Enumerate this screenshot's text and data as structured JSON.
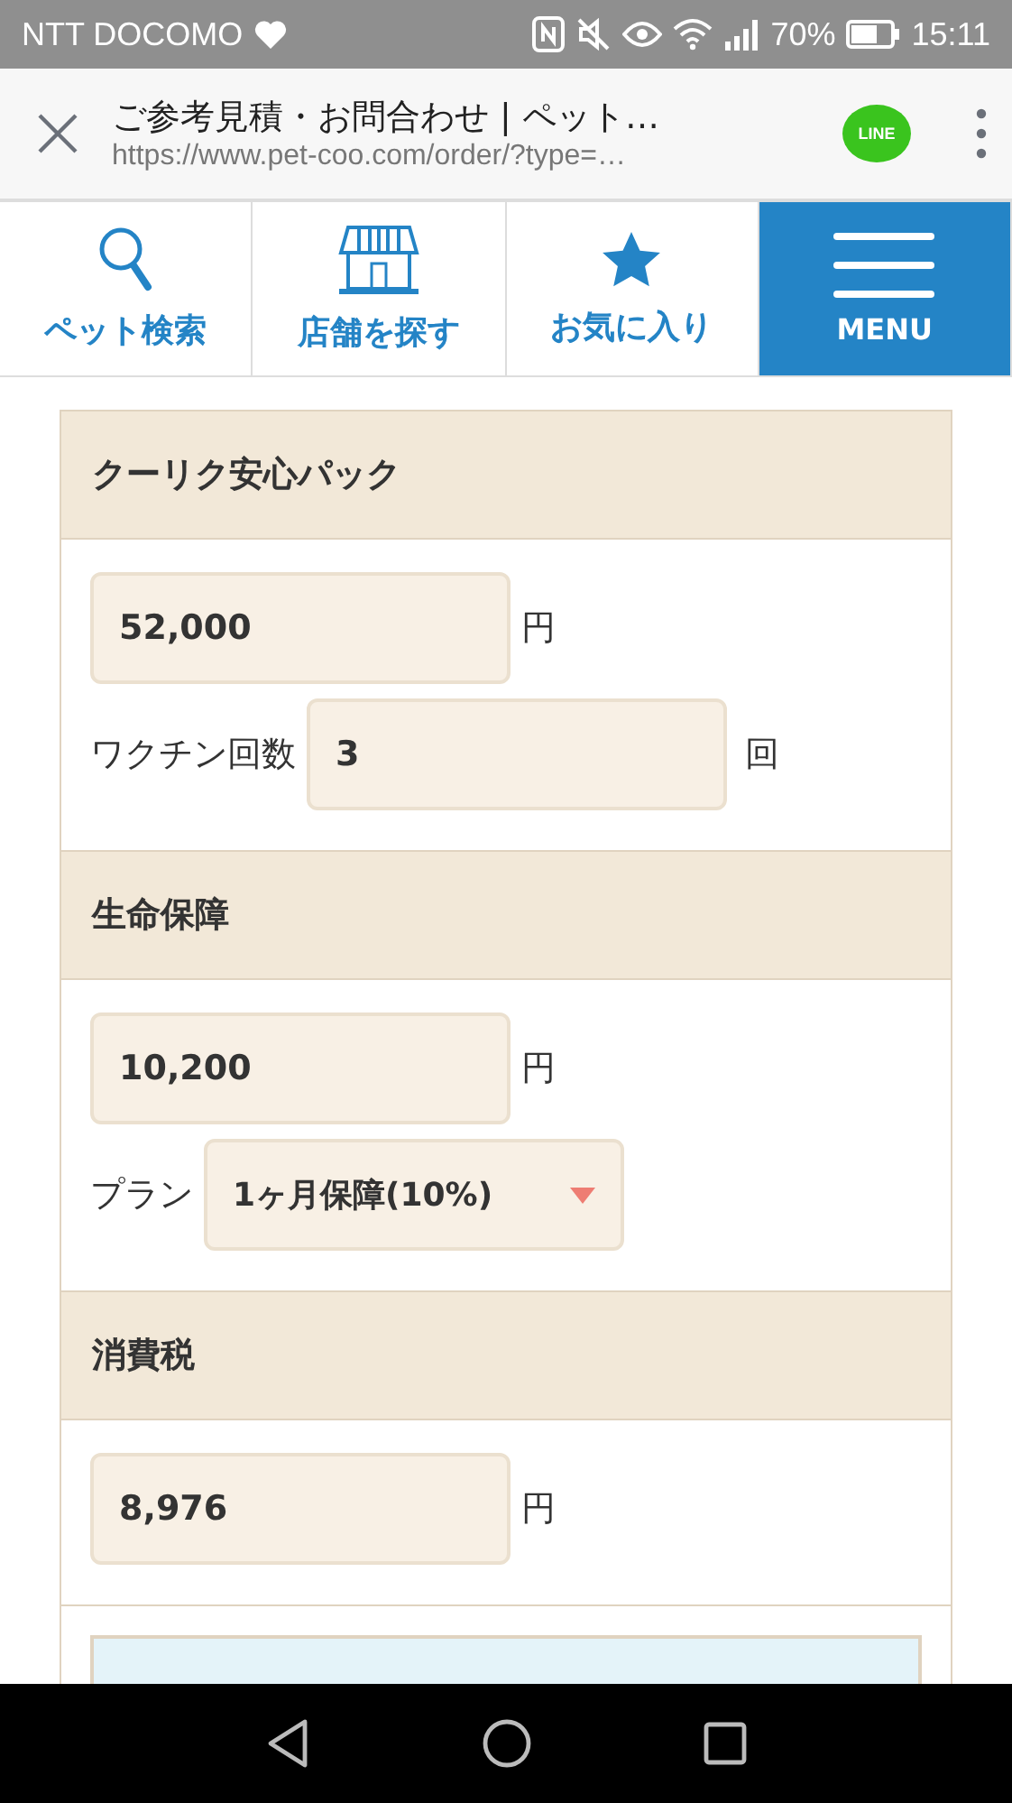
{
  "status_bar": {
    "carrier": "NTT DOCOMO",
    "battery": "70%",
    "time": "15:11"
  },
  "browser": {
    "title": "ご参考見積・お問合わせ | ペット…",
    "url": "https://www.pet-coo.com/order/?type=…",
    "line_badge": "LINE"
  },
  "nav": [
    {
      "label": "ペット検索",
      "kind": "search"
    },
    {
      "label": "店舗を探す",
      "kind": "store"
    },
    {
      "label": "お気に入り",
      "kind": "star"
    },
    {
      "label": "MENU",
      "kind": "menu"
    }
  ],
  "sections": [
    {
      "title": "クーリク安心パック",
      "rows": [
        {
          "kind": "amount",
          "value": "52,000",
          "unit": "円"
        },
        {
          "kind": "input",
          "label": "ワクチン回数",
          "value": "3",
          "unit": "回"
        }
      ]
    },
    {
      "title": "生命保障",
      "rows": [
        {
          "kind": "amount",
          "value": "10,200",
          "unit": "円"
        },
        {
          "kind": "select",
          "label": "プラン",
          "value": "1ヶ月保障(10%)"
        }
      ]
    },
    {
      "title": "消費税",
      "rows": [
        {
          "kind": "amount",
          "value": "8,976",
          "unit": "円"
        }
      ]
    }
  ],
  "footer_panel": {
    "kind": "notice"
  }
}
